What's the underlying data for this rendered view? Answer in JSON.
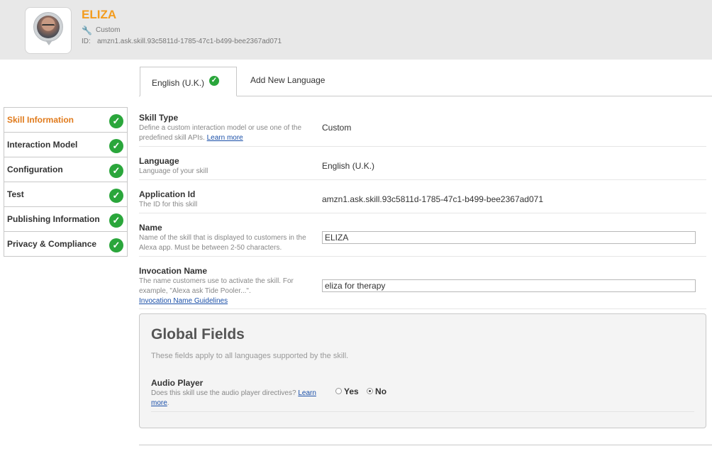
{
  "app": {
    "name": "ELIZA",
    "type": "Custom",
    "id_label": "ID:",
    "id": "amzn1.ask.skill.93c5811d-1785-47c1-b499-bee2367ad071"
  },
  "tabs": {
    "active": "English (U.K.)",
    "add": "Add New Language"
  },
  "sidebar": {
    "items": [
      {
        "label": "Skill Information",
        "active": true
      },
      {
        "label": "Interaction Model"
      },
      {
        "label": "Configuration"
      },
      {
        "label": "Test"
      },
      {
        "label": "Publishing Information"
      },
      {
        "label": "Privacy & Compliance"
      }
    ]
  },
  "fields": {
    "skill_type": {
      "title": "Skill Type",
      "desc": "Define a custom interaction model or use one of the predefined skill APIs.",
      "link": "Learn more",
      "value": "Custom"
    },
    "language": {
      "title": "Language",
      "desc": "Language of your skill",
      "value": "English (U.K.)"
    },
    "application_id": {
      "title": "Application Id",
      "desc": "The ID for this skill",
      "value": "amzn1.ask.skill.93c5811d-1785-47c1-b499-bee2367ad071"
    },
    "name": {
      "title": "Name",
      "desc": "Name of the skill that is displayed to customers in the Alexa app. Must be between 2-50 characters.",
      "value": "ELIZA"
    },
    "invocation_name": {
      "title": "Invocation Name",
      "desc": "The name customers use to activate the skill. For example, \"Alexa ask Tide Pooler...\".",
      "link": "Invocation Name Guidelines",
      "value": "eliza for therapy"
    }
  },
  "global": {
    "title": "Global Fields",
    "desc": "These fields apply to all languages supported by the skill.",
    "audio_player": {
      "title": "Audio Player",
      "desc": "Does this skill use the audio player directives?",
      "link_part1": "Learn",
      "link_part2": "more",
      "options": [
        "Yes",
        "No"
      ],
      "selected": "No"
    }
  },
  "colors": {
    "accent": "#f39c1e",
    "active_sidebar": "#e07a1b",
    "check_green": "#2aa63b",
    "link": "#1a4fa8"
  },
  "icons": {
    "type": "wrench-icon",
    "check": "check-circle-icon"
  }
}
